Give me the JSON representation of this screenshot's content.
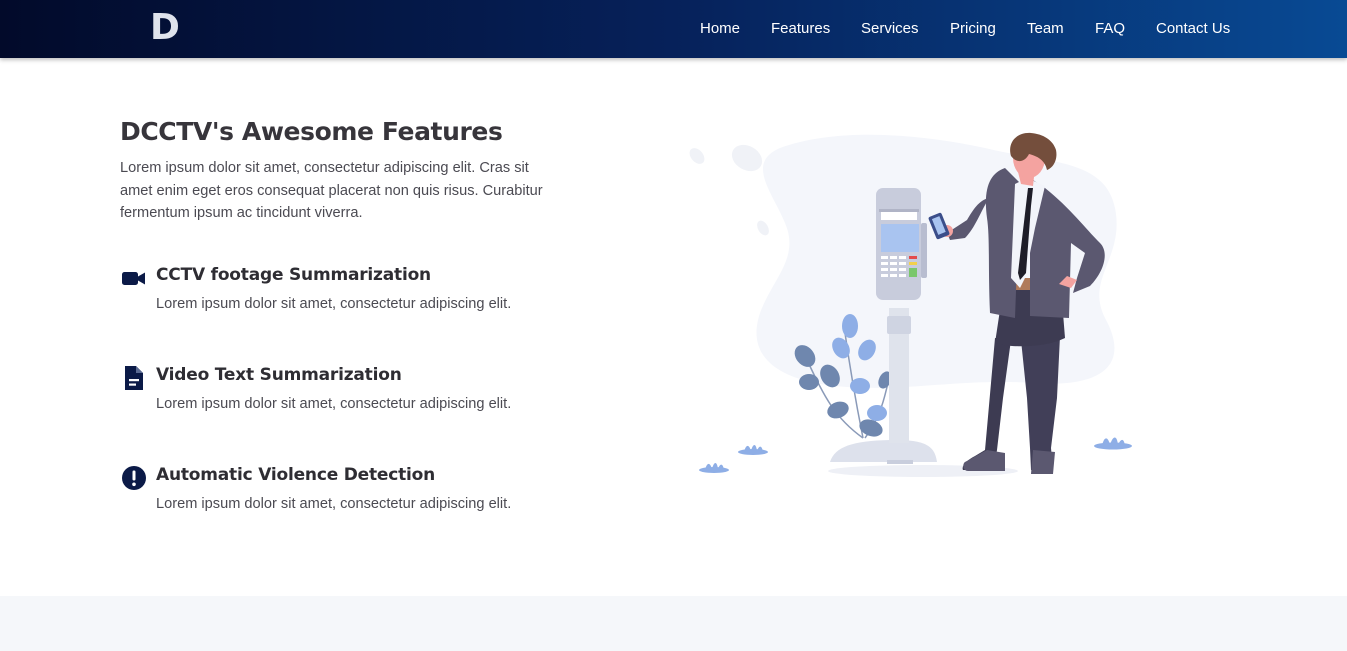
{
  "brand": {
    "logo_text": "D"
  },
  "nav": {
    "items": [
      {
        "label": "Home"
      },
      {
        "label": "Features"
      },
      {
        "label": "Services"
      },
      {
        "label": "Pricing"
      },
      {
        "label": "Team"
      },
      {
        "label": "FAQ"
      },
      {
        "label": "Contact Us"
      }
    ]
  },
  "section": {
    "title": "DCCTV's Awesome Features",
    "intro": "Lorem ipsum dolor sit amet, consectetur adipiscing elit. Cras sit amet enim eget eros consequat placerat non quis risus. Curabitur fermentum ipsum ac tincidunt viverra.",
    "features": [
      {
        "icon": "video-camera-icon",
        "title": "CCTV footage Summarization",
        "description": "Lorem ipsum dolor sit amet, consectetur adipiscing elit."
      },
      {
        "icon": "document-icon",
        "title": "Video Text Summarization",
        "description": "Lorem ipsum dolor sit amet, consectetur adipiscing elit."
      },
      {
        "icon": "alert-circle-icon",
        "title": "Automatic Violence Detection",
        "description": "Lorem ipsum dolor sit amet, consectetur adipiscing elit."
      }
    ]
  },
  "colors": {
    "navbar_gradient_start": "#020a2a",
    "navbar_gradient_end": "#084a94",
    "icon_color": "#0b1a47",
    "heading_color": "#37353b",
    "body_text_color": "#4b4a52",
    "bottom_band": "#f5f7fa"
  }
}
